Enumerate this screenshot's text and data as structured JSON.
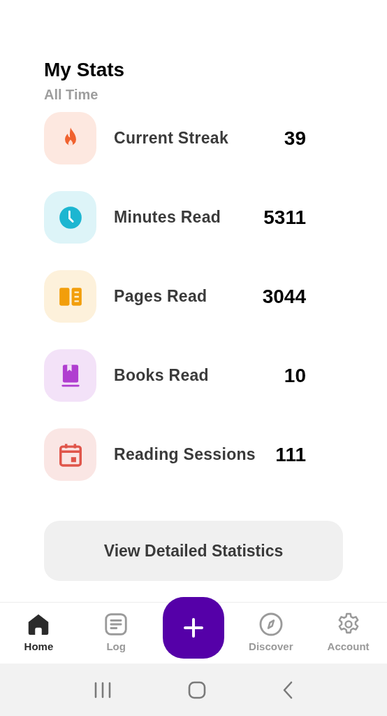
{
  "header": {
    "title": "My Stats",
    "subtitle": "All Time"
  },
  "stats": [
    {
      "kind": "flame",
      "color": "#f0622f",
      "label": "Current Streak",
      "value": "39"
    },
    {
      "kind": "clock",
      "color": "#1cb6d1",
      "label": "Minutes Read",
      "value": "5311"
    },
    {
      "kind": "pages",
      "color": "#f29e0b",
      "label": "Pages Read",
      "value": "3044"
    },
    {
      "kind": "book",
      "color": "#b03ed0",
      "label": "Books Read",
      "value": "10"
    },
    {
      "kind": "calendar",
      "color": "#e0554a",
      "label": "Reading Sessions",
      "value": "111"
    }
  ],
  "details_button": "View Detailed Statistics",
  "nav": [
    {
      "kind": "home",
      "label": "Home",
      "selected": true
    },
    {
      "kind": "log",
      "label": "Log",
      "selected": false
    },
    {
      "kind": "add",
      "selected": false
    },
    {
      "kind": "discover",
      "label": "Discover",
      "selected": false
    },
    {
      "kind": "account",
      "label": "Account",
      "selected": false
    }
  ]
}
